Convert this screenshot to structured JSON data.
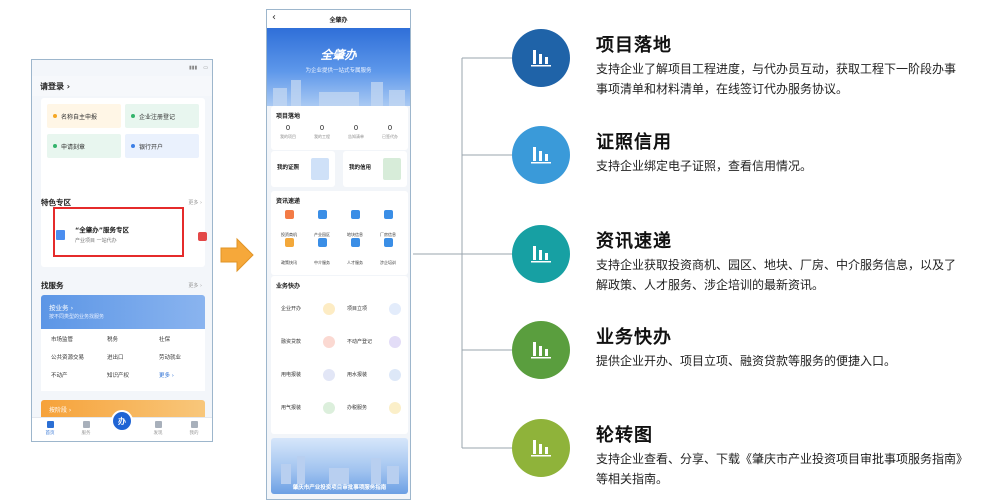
{
  "phone1": {
    "login": "请登录 ›",
    "quick": [
      "名称自主申报",
      "企业注册登记",
      "申请刻章",
      "银行开户"
    ],
    "special_title": "特色专区",
    "special_more": "更多 ›",
    "special_card_title": "“全肇办”服务专区",
    "special_card_sub": "产业项目 一站代办",
    "find_title": "找服务",
    "find_more": "更多 ›",
    "biz_head": "按业务 ›",
    "biz_head_sub": "按不同类型的业务找服务",
    "biz_items": [
      "市场监管",
      "税务",
      "社保",
      "公共资源交易",
      "进出口",
      "劳动就业",
      "不动产",
      "知识产权",
      "更多 ›"
    ],
    "step_head": "按阶段 ›",
    "tabs": [
      "首页",
      "服务",
      "办",
      "发现",
      "我的"
    ]
  },
  "phone2": {
    "nav_title": "全肇办",
    "logo": "全肇办",
    "slogan": "为企业提供一站式专属服务",
    "project_title": "项目落地",
    "stats": [
      {
        "n": "0",
        "l": "我的项目"
      },
      {
        "n": "0",
        "l": "我的工程"
      },
      {
        "n": "0",
        "l": "告知清单"
      },
      {
        "n": "0",
        "l": "已签代办"
      }
    ],
    "cert_label": "我的证照",
    "credit_label": "我的信用",
    "info_title": "资讯速递",
    "info_items": [
      "投资商机",
      "产业园区",
      "地块信息",
      "厂房信息",
      "政策快讯",
      "中介服务",
      "人才服务",
      "涉企培训"
    ],
    "biz_title": "业务快办",
    "biz_items": [
      "企业开办",
      "项目立项",
      "融资贷款",
      "不动产登记",
      "用电报装",
      "用水报装",
      "用气报装",
      "办税服务"
    ],
    "guide_caption": "肇庆市产业投资项目审批事项服务指南"
  },
  "features": [
    {
      "title": "项目落地",
      "desc": "支持企业了解项目工程进度，与代办员互动，获取工程下一阶段办事事项清单和材料清单，在线签订代办服务协议。",
      "color": "#1f63a8",
      "icon": "bar-chart-icon"
    },
    {
      "title": "证照信用",
      "desc": "支持企业绑定电子证照，查看信用情况。",
      "color": "#3a9ad9",
      "icon": "bar-chart-icon"
    },
    {
      "title": "资讯速递",
      "desc": "支持企业获取投资商机、园区、地块、厂房、中介服务信息，以及了解政策、人才服务、涉企培训的最新资讯。",
      "color": "#17a0a3",
      "icon": "bar-chart-icon"
    },
    {
      "title": "业务快办",
      "desc": "提供企业开办、项目立项、融资贷款等服务的便捷入口。",
      "color": "#5a9e3e",
      "icon": "bar-chart-icon"
    },
    {
      "title": "轮转图",
      "desc": "支持企业查看、分享、下载《肇庆市产业投资项目审批事项服务指南》等相关指南。",
      "color": "#8fb33a",
      "icon": "bar-chart-icon"
    }
  ]
}
